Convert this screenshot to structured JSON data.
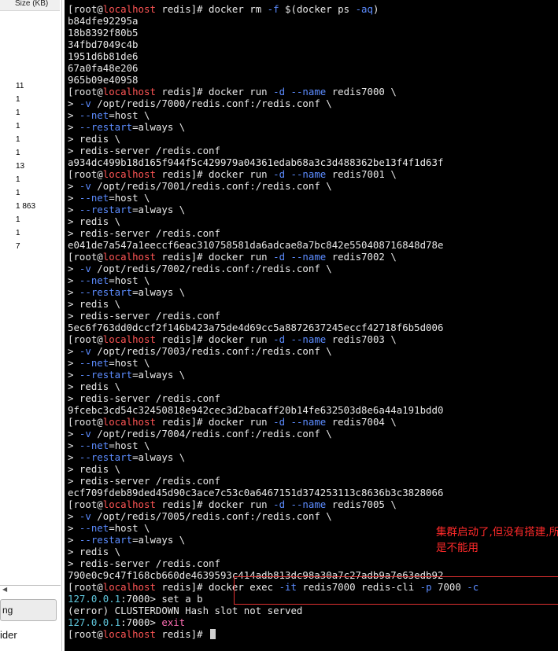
{
  "file_panel": {
    "size_header": "Size (KB)",
    "sizes": [
      "11",
      "1",
      "1",
      "1",
      "1",
      "1",
      "13",
      "1",
      "1",
      "1 863",
      "1",
      "1",
      "7"
    ],
    "button_label": "ng",
    "bottom_label": "ider"
  },
  "terminal": {
    "lines": [
      [
        [
          "[root@",
          "def"
        ],
        [
          "localhost",
          "red"
        ],
        [
          " redis]# docker rm ",
          "def"
        ],
        [
          "-f",
          "blue"
        ],
        [
          " $(docker ps ",
          "def"
        ],
        [
          "-aq",
          "blue"
        ],
        [
          ")",
          "def"
        ]
      ],
      [
        [
          "b84dfe92295a",
          "def"
        ]
      ],
      [
        [
          "18b8392f80b5",
          "def"
        ]
      ],
      [
        [
          "34fbd7049c4b",
          "def"
        ]
      ],
      [
        [
          "1951d6b81de6",
          "def"
        ]
      ],
      [
        [
          "67a0fa48e206",
          "def"
        ]
      ],
      [
        [
          "965b09e40958",
          "def"
        ]
      ],
      [
        [
          "[root@",
          "def"
        ],
        [
          "localhost",
          "red"
        ],
        [
          " redis]# docker run ",
          "def"
        ],
        [
          "-d",
          "blue"
        ],
        [
          " ",
          "def"
        ],
        [
          "--name",
          "blue"
        ],
        [
          " redis7000 \\",
          "def"
        ]
      ],
      [
        [
          "> ",
          "def"
        ],
        [
          "-v",
          "blue"
        ],
        [
          " /opt/redis/7000/redis.conf:/redis.conf \\",
          "def"
        ]
      ],
      [
        [
          "> ",
          "def"
        ],
        [
          "--net",
          "blue"
        ],
        [
          "=host \\",
          "def"
        ]
      ],
      [
        [
          "> ",
          "def"
        ],
        [
          "--restart",
          "blue"
        ],
        [
          "=always \\",
          "def"
        ]
      ],
      [
        [
          "> redis \\",
          "def"
        ]
      ],
      [
        [
          "> redis-server /redis.conf",
          "def"
        ]
      ],
      [
        [
          "a934dc499b18d165f944f5c429979a04361edab68a3c3d488362be13f4f1d63f",
          "def"
        ]
      ],
      [
        [
          "[root@",
          "def"
        ],
        [
          "localhost",
          "red"
        ],
        [
          " redis]# docker run ",
          "def"
        ],
        [
          "-d",
          "blue"
        ],
        [
          " ",
          "def"
        ],
        [
          "--name",
          "blue"
        ],
        [
          " redis7001 \\",
          "def"
        ]
      ],
      [
        [
          "> ",
          "def"
        ],
        [
          "-v",
          "blue"
        ],
        [
          " /opt/redis/7001/redis.conf:/redis.conf \\",
          "def"
        ]
      ],
      [
        [
          "> ",
          "def"
        ],
        [
          "--net",
          "blue"
        ],
        [
          "=host \\",
          "def"
        ]
      ],
      [
        [
          "> ",
          "def"
        ],
        [
          "--restart",
          "blue"
        ],
        [
          "=always \\",
          "def"
        ]
      ],
      [
        [
          "> redis \\",
          "def"
        ]
      ],
      [
        [
          "> redis-server /redis.conf",
          "def"
        ]
      ],
      [
        [
          "e041de7a547a1eeccf6eac310758581da6adcae8a7bc842e550408716848d78e",
          "def"
        ]
      ],
      [
        [
          "[root@",
          "def"
        ],
        [
          "localhost",
          "red"
        ],
        [
          " redis]# docker run ",
          "def"
        ],
        [
          "-d",
          "blue"
        ],
        [
          " ",
          "def"
        ],
        [
          "--name",
          "blue"
        ],
        [
          " redis7002 \\",
          "def"
        ]
      ],
      [
        [
          "> ",
          "def"
        ],
        [
          "-v",
          "blue"
        ],
        [
          " /opt/redis/7002/redis.conf:/redis.conf \\",
          "def"
        ]
      ],
      [
        [
          "> ",
          "def"
        ],
        [
          "--net",
          "blue"
        ],
        [
          "=host \\",
          "def"
        ]
      ],
      [
        [
          "> ",
          "def"
        ],
        [
          "--restart",
          "blue"
        ],
        [
          "=always \\",
          "def"
        ]
      ],
      [
        [
          "> redis \\",
          "def"
        ]
      ],
      [
        [
          "> redis-server /redis.conf",
          "def"
        ]
      ],
      [
        [
          "5ec6f763dd0dccf2f146b423a75de4d69cc5a8872637245eccf42718f6b5d006",
          "def"
        ]
      ],
      [
        [
          "[root@",
          "def"
        ],
        [
          "localhost",
          "red"
        ],
        [
          " redis]# docker run ",
          "def"
        ],
        [
          "-d",
          "blue"
        ],
        [
          " ",
          "def"
        ],
        [
          "--name",
          "blue"
        ],
        [
          " redis7003 \\",
          "def"
        ]
      ],
      [
        [
          "> ",
          "def"
        ],
        [
          "-v",
          "blue"
        ],
        [
          " /opt/redis/7003/redis.conf:/redis.conf \\",
          "def"
        ]
      ],
      [
        [
          "> ",
          "def"
        ],
        [
          "--net",
          "blue"
        ],
        [
          "=host \\",
          "def"
        ]
      ],
      [
        [
          "> ",
          "def"
        ],
        [
          "--restart",
          "blue"
        ],
        [
          "=always \\",
          "def"
        ]
      ],
      [
        [
          "> redis \\",
          "def"
        ]
      ],
      [
        [
          "> redis-server /redis.conf",
          "def"
        ]
      ],
      [
        [
          "9fcebc3cd54c32450818e942cec3d2bacaff20b14fe632503d8e6a44a191bdd0",
          "def"
        ]
      ],
      [
        [
          "[root@",
          "def"
        ],
        [
          "localhost",
          "red"
        ],
        [
          " redis]# docker run ",
          "def"
        ],
        [
          "-d",
          "blue"
        ],
        [
          " ",
          "def"
        ],
        [
          "--name",
          "blue"
        ],
        [
          " redis7004 \\",
          "def"
        ]
      ],
      [
        [
          "> ",
          "def"
        ],
        [
          "-v",
          "blue"
        ],
        [
          " /opt/redis/7004/redis.conf:/redis.conf \\",
          "def"
        ]
      ],
      [
        [
          "> ",
          "def"
        ],
        [
          "--net",
          "blue"
        ],
        [
          "=host \\",
          "def"
        ]
      ],
      [
        [
          "> ",
          "def"
        ],
        [
          "--restart",
          "blue"
        ],
        [
          "=always \\",
          "def"
        ]
      ],
      [
        [
          "> redis \\",
          "def"
        ]
      ],
      [
        [
          "> redis-server /redis.conf",
          "def"
        ]
      ],
      [
        [
          "ecf709fdeb89ded45d90c3ace7c53c0a6467151d374253113c8636b3c3828066",
          "def"
        ]
      ],
      [
        [
          "[root@",
          "def"
        ],
        [
          "localhost",
          "red"
        ],
        [
          " redis]# docker run ",
          "def"
        ],
        [
          "-d",
          "blue"
        ],
        [
          " ",
          "def"
        ],
        [
          "--name",
          "blue"
        ],
        [
          " redis7005 \\",
          "def"
        ]
      ],
      [
        [
          "> ",
          "def"
        ],
        [
          "-v",
          "blue"
        ],
        [
          " /opt/redis/7005/redis.conf:/redis.conf \\",
          "def"
        ]
      ],
      [
        [
          "> ",
          "def"
        ],
        [
          "--net",
          "blue"
        ],
        [
          "=host \\",
          "def"
        ]
      ],
      [
        [
          "> ",
          "def"
        ],
        [
          "--restart",
          "blue"
        ],
        [
          "=always \\",
          "def"
        ]
      ],
      [
        [
          "> redis \\",
          "def"
        ]
      ],
      [
        [
          "> redis-server /redis.conf",
          "def"
        ]
      ],
      [
        [
          "790e0c9c47f168cb660de4639593c414adb813dc98a30a7c27adb9a7e63edb92",
          "def"
        ]
      ],
      [
        [
          "[root@",
          "def"
        ],
        [
          "localhost",
          "red"
        ],
        [
          " redis]# docker exec ",
          "def"
        ],
        [
          "-it",
          "blue"
        ],
        [
          " redis7000 redis-cli ",
          "def"
        ],
        [
          "-p",
          "blue"
        ],
        [
          " 7000 ",
          "def"
        ],
        [
          "-c",
          "blue"
        ]
      ],
      [
        [
          "127.0.0.1",
          "cyan"
        ],
        [
          ":7000> set a b",
          "def"
        ]
      ],
      [
        [
          "(error) CLUSTERDOWN Hash slot not served",
          "def"
        ]
      ],
      [
        [
          "127.0.0.1",
          "cyan"
        ],
        [
          ":7000> ",
          "def"
        ],
        [
          "exit",
          "mag"
        ]
      ],
      [
        [
          "[root@",
          "def"
        ],
        [
          "localhost",
          "red"
        ],
        [
          " redis]# ",
          "def"
        ]
      ]
    ]
  },
  "annotation": {
    "line1": "集群启动了,但没有搭建,所以还j",
    "line2": "是不能用",
    "color": "#ff2a2a"
  },
  "colors": {
    "terminal_bg": "#000000",
    "text": "#e8e8e8",
    "hostname": "#ff5555",
    "option": "#5c8cff",
    "ip": "#5fc6dc",
    "exit": "#ff6eb4"
  }
}
